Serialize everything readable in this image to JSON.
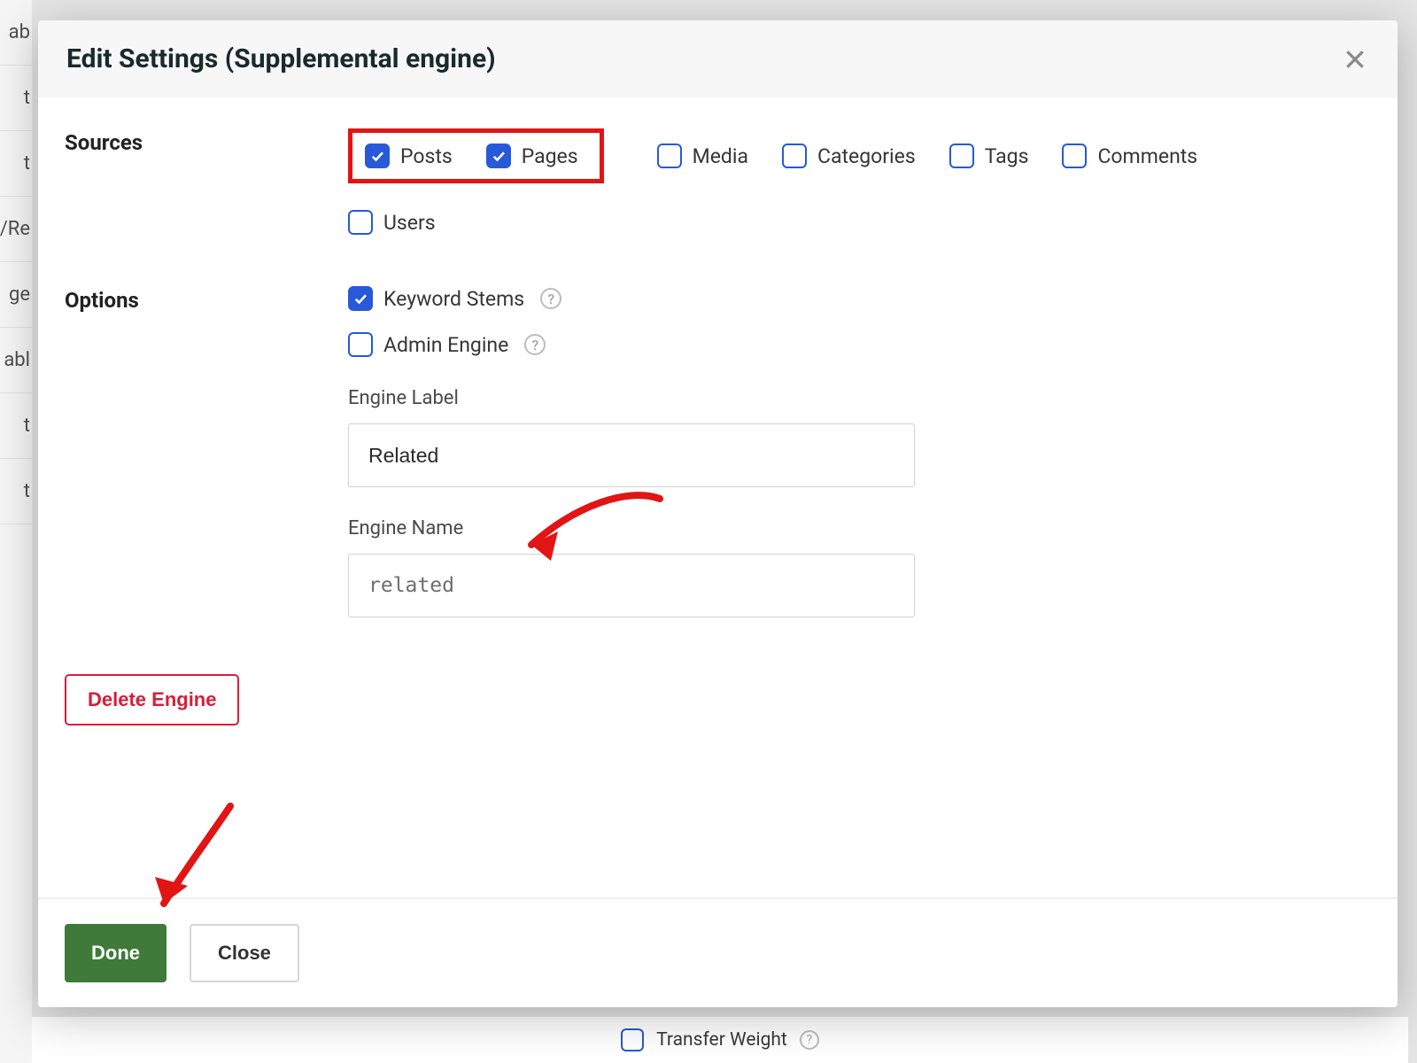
{
  "modal": {
    "title": "Edit Settings (Supplemental engine)",
    "sections": {
      "sources": {
        "label": "Sources",
        "items": {
          "posts": {
            "label": "Posts",
            "checked": true
          },
          "pages": {
            "label": "Pages",
            "checked": true
          },
          "media": {
            "label": "Media",
            "checked": false
          },
          "categories": {
            "label": "Categories",
            "checked": false
          },
          "tags": {
            "label": "Tags",
            "checked": false
          },
          "comments": {
            "label": "Comments",
            "checked": false
          },
          "users": {
            "label": "Users",
            "checked": false
          }
        }
      },
      "options": {
        "label": "Options",
        "keyword_stems": {
          "label": "Keyword Stems",
          "checked": true
        },
        "admin_engine": {
          "label": "Admin Engine",
          "checked": false
        }
      },
      "engine_label": {
        "label": "Engine Label",
        "value": "Related"
      },
      "engine_name": {
        "label": "Engine Name",
        "value": "related"
      }
    },
    "buttons": {
      "delete": "Delete Engine",
      "done": "Done",
      "close": "Close"
    }
  },
  "background": {
    "nav_fragments": [
      "ab",
      "t",
      "t",
      "/Re",
      "ge",
      "abl",
      "t",
      "t"
    ],
    "transfer_weight": "Transfer Weight"
  },
  "annotations": {
    "highlight_sources": [
      "posts",
      "pages"
    ],
    "arrow_engine_label": true,
    "arrow_done": true
  }
}
